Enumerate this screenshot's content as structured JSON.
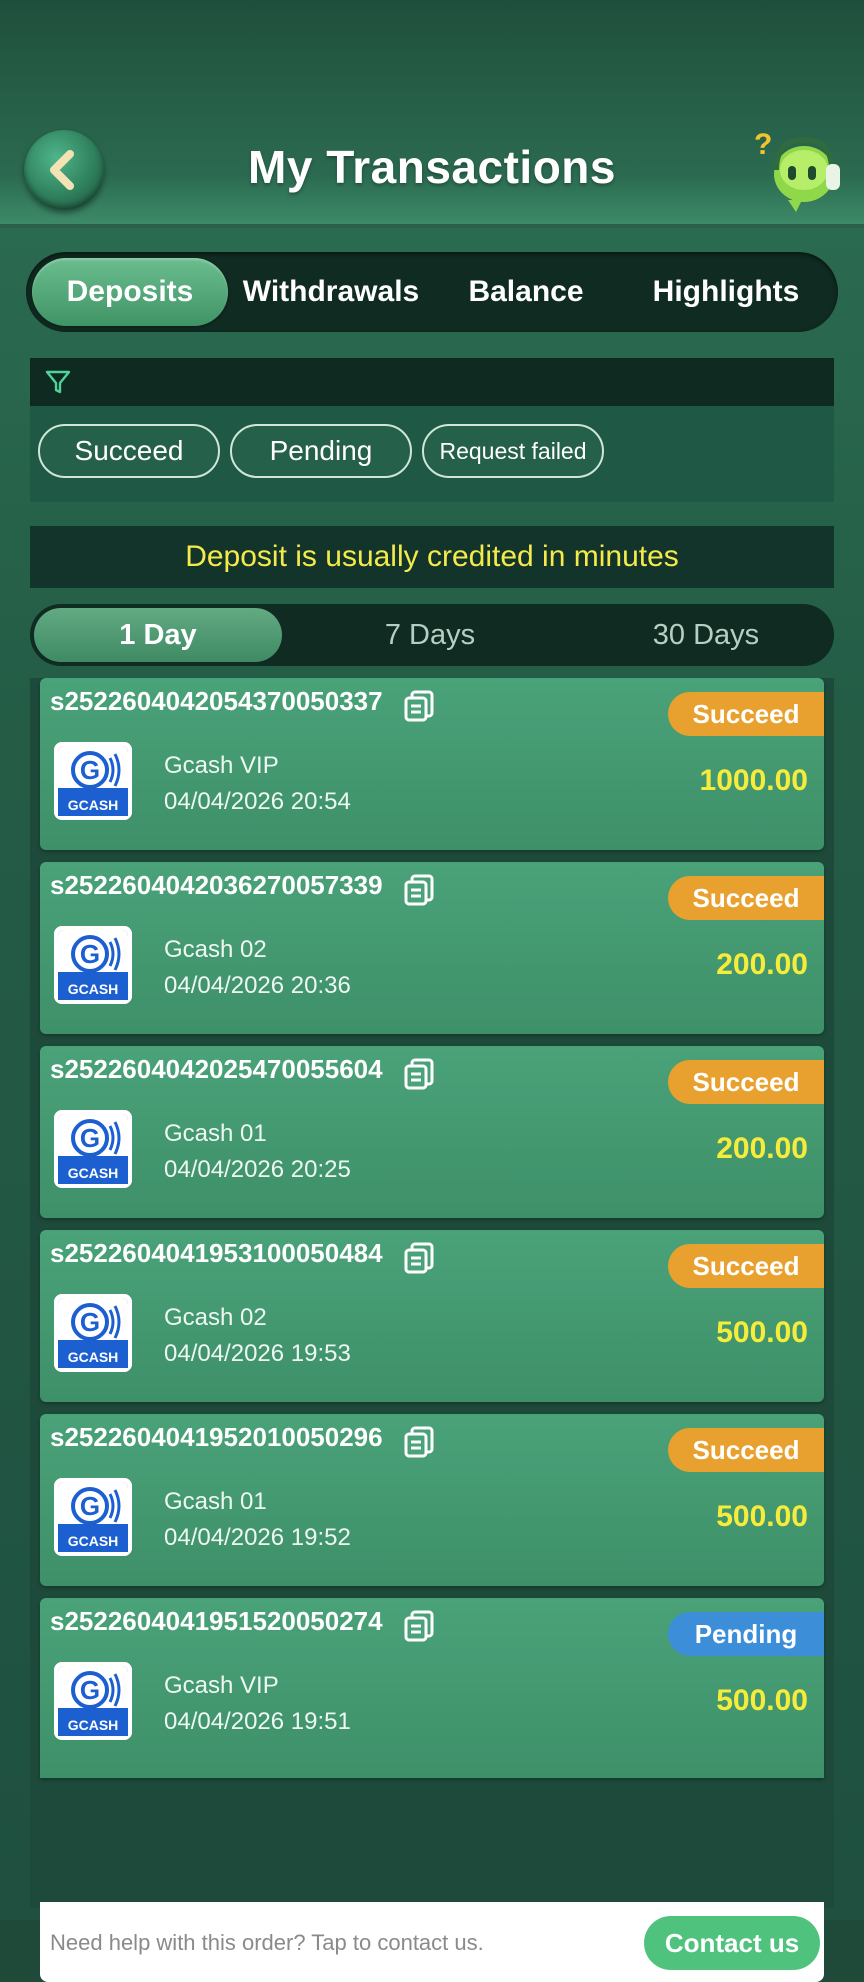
{
  "header": {
    "title": "My Transactions",
    "back_icon": "chevron-left-icon",
    "support_icon": "customer-support-robot-icon"
  },
  "tabs": [
    {
      "label": "Deposits",
      "active": true
    },
    {
      "label": "Withdrawals",
      "active": false
    },
    {
      "label": "Balance",
      "active": false
    },
    {
      "label": "Highlights",
      "active": false
    }
  ],
  "filter": {
    "icon": "filter-icon",
    "chips": [
      "Succeed",
      "Pending",
      "Request failed"
    ]
  },
  "notice": "Deposit is usually credited in minutes",
  "periods": [
    {
      "label": "1 Day",
      "active": true
    },
    {
      "label": "7 Days",
      "active": false
    },
    {
      "label": "30 Days",
      "active": false
    }
  ],
  "transactions": [
    {
      "id": "s2522604042054370050337",
      "method": "Gcash VIP",
      "datetime": "04/04/2026 20:54",
      "amount": "1000.00",
      "status": "Succeed"
    },
    {
      "id": "s2522604042036270057339",
      "method": "Gcash 02",
      "datetime": "04/04/2026 20:36",
      "amount": "200.00",
      "status": "Succeed"
    },
    {
      "id": "s2522604042025470055604",
      "method": "Gcash 01",
      "datetime": "04/04/2026 20:25",
      "amount": "200.00",
      "status": "Succeed"
    },
    {
      "id": "s2522604041953100050484",
      "method": "Gcash 02",
      "datetime": "04/04/2026 19:53",
      "amount": "500.00",
      "status": "Succeed"
    },
    {
      "id": "s2522604041952010050296",
      "method": "Gcash 01",
      "datetime": "04/04/2026 19:52",
      "amount": "500.00",
      "status": "Succeed"
    },
    {
      "id": "s2522604041951520050274",
      "method": "Gcash VIP",
      "datetime": "04/04/2026 19:51",
      "amount": "500.00",
      "status": "Pending"
    }
  ],
  "logo_text": "GCASH",
  "help": {
    "text": "Need help with this order? Tap to contact us.",
    "button": "Contact us"
  },
  "colors": {
    "accent": "#4aa279",
    "amount": "#f6ec3c",
    "succeed": "#e8a12e",
    "pending": "#3c8ed8",
    "notice": "#f4ea4a"
  }
}
